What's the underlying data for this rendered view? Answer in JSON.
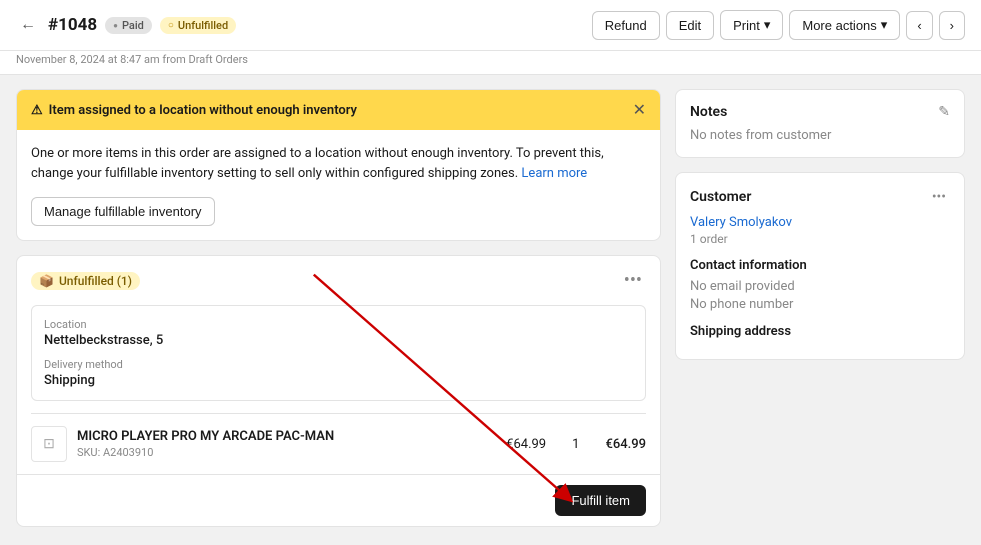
{
  "header": {
    "order_number": "#1048",
    "back_icon": "←",
    "badge_paid": "Paid",
    "badge_unfulfilled": "Unfulfilled",
    "subtitle": "November 8, 2024 at 8:47 am from Draft Orders",
    "actions": {
      "refund": "Refund",
      "edit": "Edit",
      "print": "Print",
      "more_actions": "More actions",
      "prev_icon": "‹",
      "next_icon": "›"
    }
  },
  "alert": {
    "title": "Item assigned to a location without enough inventory",
    "body": "One or more items in this order are assigned to a location without enough inventory. To prevent this, change your fulfillable inventory setting to sell only within configured shipping zones.",
    "learn_more": "Learn more",
    "manage_btn": "Manage fulfillable inventory",
    "close_icon": "✕"
  },
  "unfulfilled": {
    "badge": "Unfulfilled (1)",
    "location_label": "Location",
    "location_value": "Nettelbeckstrasse, 5",
    "delivery_label": "Delivery method",
    "delivery_value": "Shipping",
    "product_name": "MICRO PLAYER PRO MY ARCADE PAC-MAN",
    "product_sku": "SKU: A2403910",
    "product_price": "€64.99",
    "product_qty": "1",
    "product_total": "€64.99",
    "fulfill_btn": "Fulfill item"
  },
  "notes": {
    "title": "Notes",
    "body": "No notes from customer",
    "edit_icon": "✎"
  },
  "customer": {
    "title": "Customer",
    "name": "Valery Smolyakov",
    "orders": "1 order",
    "contact_title": "Contact information",
    "email": "No email provided",
    "phone": "No phone number",
    "shipping_title": "Shipping address"
  }
}
